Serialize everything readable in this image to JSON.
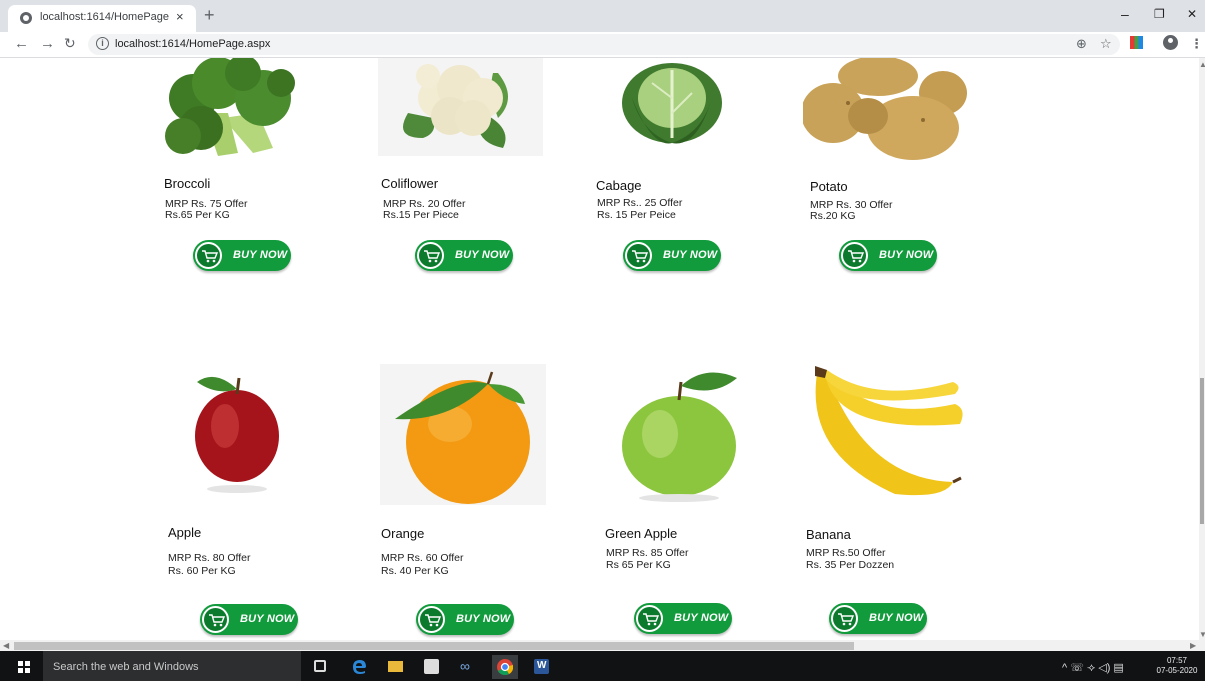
{
  "browser": {
    "tab_title": "localhost:1614/HomePage.aspx",
    "tab_close": "×",
    "new_tab": "+",
    "url": "localhost:1614/HomePage.aspx",
    "minimize": "–",
    "restore": "❐",
    "close": "✕"
  },
  "buy_label": "BUY NOW",
  "products": [
    {
      "name": "Broccoli",
      "price_line1": "MRP Rs. 75 Offer",
      "price_line2": "Rs.65 Per KG",
      "icon": "broccoli-image"
    },
    {
      "name": "Coliflower",
      "price_line1": "MRP Rs. 20 Offer",
      "price_line2": "Rs.15 Per Piece",
      "icon": "cauliflower-image"
    },
    {
      "name": "Cabage",
      "price_line1": "MRP Rs.. 25 Offer",
      "price_line2": "Rs. 15 Per Peice",
      "icon": "cabbage-image"
    },
    {
      "name": "Potato",
      "price_line1": "MRP Rs. 30 Offer",
      "price_line2": "Rs.20 KG",
      "icon": "potato-image"
    },
    {
      "name": "Apple",
      "price_line1": "MRP Rs. 80 Offer",
      "price_line2": "Rs. 60 Per KG",
      "icon": "apple-image"
    },
    {
      "name": "Orange",
      "price_line1": "MRP Rs. 60 Offer",
      "price_line2": "Rs. 40 Per KG",
      "icon": "orange-image"
    },
    {
      "name": "Green Apple",
      "price_line1": "MRP Rs. 85 Offer",
      "price_line2": "Rs 65 Per KG",
      "icon": "green-apple-image"
    },
    {
      "name": "Banana",
      "price_line1": "MRP Rs.50 Offer",
      "price_line2": "Rs. 35 Per Dozzen",
      "icon": "banana-image"
    }
  ],
  "taskbar": {
    "search_placeholder": "Search the web and Windows",
    "time": "07:57",
    "date": "07-05-2020"
  },
  "colors": {
    "buy_button": "#129b3c",
    "taskbar": "#101214"
  }
}
